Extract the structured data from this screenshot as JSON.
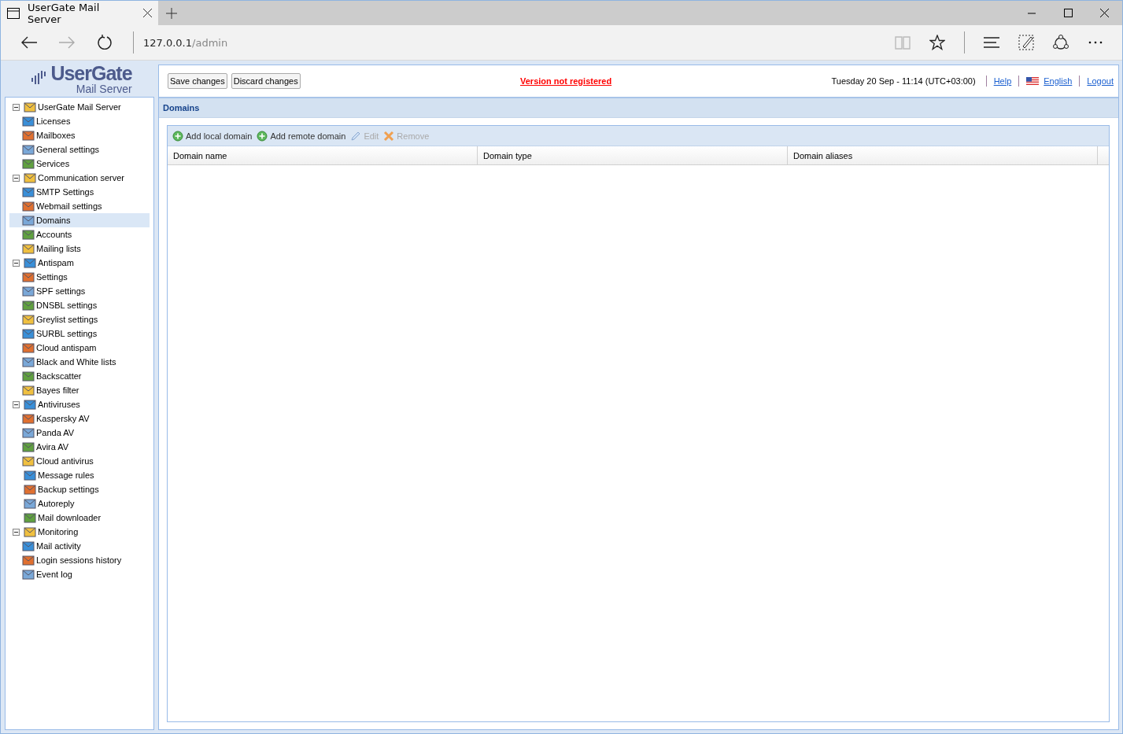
{
  "browser": {
    "tab_title": "UserGate Mail Server",
    "address_host": "127.0.0.1",
    "address_path": "/admin"
  },
  "logo": {
    "title": "UserGate",
    "subtitle": "Mail Server"
  },
  "tree": [
    {
      "label": "UserGate Mail Server",
      "expanded": true,
      "selected": false,
      "children": [
        {
          "label": "Licenses",
          "selected": false
        },
        {
          "label": "Mailboxes",
          "selected": false
        },
        {
          "label": "General settings",
          "selected": false
        },
        {
          "label": "Services",
          "selected": false
        }
      ]
    },
    {
      "label": "Communication server",
      "expanded": true,
      "selected": false,
      "children": [
        {
          "label": "SMTP Settings",
          "selected": false
        },
        {
          "label": "Webmail settings",
          "selected": false
        },
        {
          "label": "Domains",
          "selected": true
        },
        {
          "label": "Accounts",
          "selected": false
        },
        {
          "label": "Mailing lists",
          "selected": false
        }
      ]
    },
    {
      "label": "Antispam",
      "expanded": true,
      "selected": false,
      "children": [
        {
          "label": "Settings",
          "selected": false
        },
        {
          "label": "SPF settings",
          "selected": false
        },
        {
          "label": "DNSBL settings",
          "selected": false
        },
        {
          "label": "Greylist settings",
          "selected": false
        },
        {
          "label": "SURBL settings",
          "selected": false
        },
        {
          "label": "Cloud antispam",
          "selected": false
        },
        {
          "label": "Black and White lists",
          "selected": false
        },
        {
          "label": "Backscatter",
          "selected": false
        },
        {
          "label": "Bayes filter",
          "selected": false
        }
      ]
    },
    {
      "label": "Antiviruses",
      "expanded": true,
      "selected": false,
      "children": [
        {
          "label": "Kaspersky AV",
          "selected": false
        },
        {
          "label": "Panda AV",
          "selected": false
        },
        {
          "label": "Avira AV",
          "selected": false
        },
        {
          "label": "Cloud antivirus",
          "selected": false
        }
      ]
    },
    {
      "label": "Message rules",
      "selected": false
    },
    {
      "label": "Backup settings",
      "selected": false
    },
    {
      "label": "Autoreply",
      "selected": false
    },
    {
      "label": "Mail downloader",
      "selected": false
    },
    {
      "label": "Monitoring",
      "expanded": true,
      "selected": false,
      "children": [
        {
          "label": "Mail activity",
          "selected": false
        },
        {
          "label": "Login sessions history",
          "selected": false
        },
        {
          "label": "Event log",
          "selected": false
        }
      ]
    }
  ],
  "topbar": {
    "buttons": [
      "Save changes",
      "Discard changes"
    ],
    "notice": "Version not registered",
    "datetime": "Tuesday 20 Sep - 11:14 (UTC+03:00)",
    "links": [
      {
        "kind": "help",
        "label": "Help"
      },
      {
        "kind": "language",
        "label": "English"
      },
      {
        "kind": "logout",
        "label": "Logout"
      }
    ]
  },
  "section_title": "Domains",
  "toolbar": [
    {
      "kind": "add",
      "label": "Add local domain",
      "disabled": false
    },
    {
      "kind": "add",
      "label": "Add remote domain",
      "disabled": false
    },
    {
      "kind": "edit",
      "label": "Edit",
      "disabled": true
    },
    {
      "kind": "remove",
      "label": "Remove",
      "disabled": true
    }
  ],
  "table": {
    "columns": [
      "Domain name",
      "Domain type",
      "Domain aliases"
    ]
  }
}
